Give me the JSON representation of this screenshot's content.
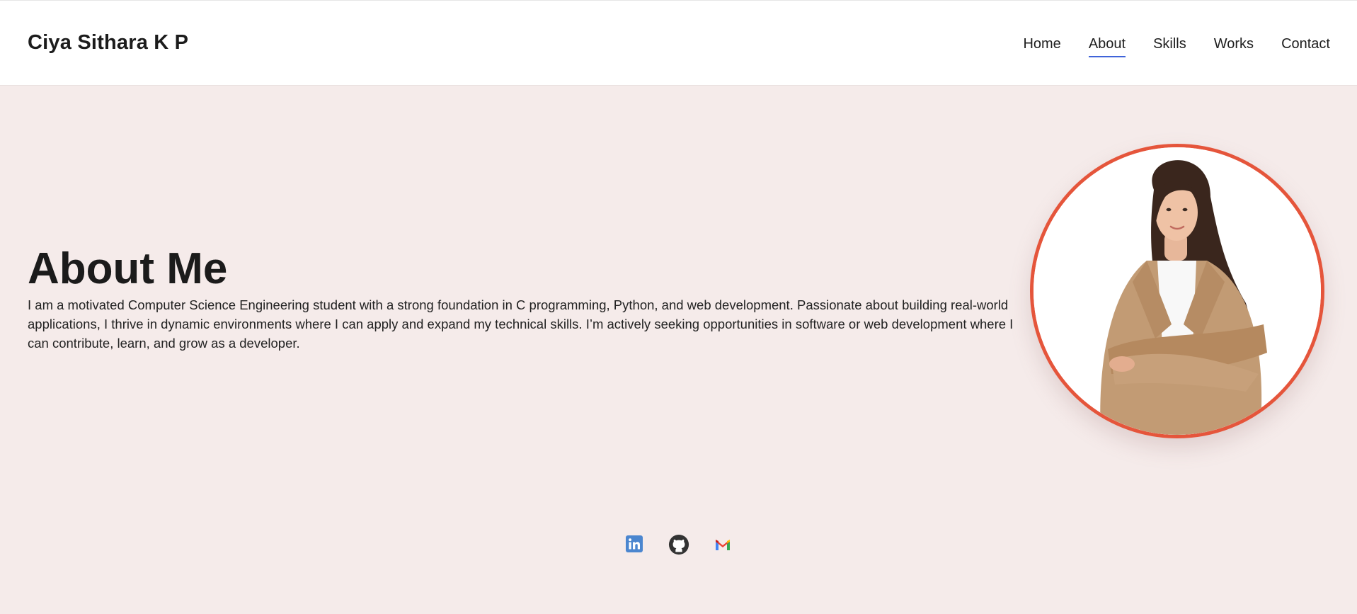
{
  "header": {
    "brand": "Ciya Sithara K P",
    "nav": [
      {
        "label": "Home"
      },
      {
        "label": "About",
        "active": true
      },
      {
        "label": "Skills"
      },
      {
        "label": "Works"
      },
      {
        "label": "Contact"
      }
    ],
    "active_underline_color": "#3f63d9"
  },
  "about": {
    "title": "About Me",
    "text": "I am a motivated Computer Science Engineering student with a strong foundation in C programming, Python, and web development. Passionate about building real-world applications, I thrive in dynamic environments where I can apply and expand my technical skills. I’m actively seeking opportunities in software or web development where I can contribute, learn, and grow as a developer."
  },
  "portrait": {
    "icon": "profile-photo",
    "border_color": "#e5553b"
  },
  "socials": [
    {
      "icon": "linkedin-icon",
      "color": "#0a66c2"
    },
    {
      "icon": "github-icon",
      "color": "#24292f"
    },
    {
      "icon": "gmail-icon",
      "color": "#ea4335"
    }
  ],
  "colors": {
    "background": "#f5ebea",
    "header_background": "#ffffff"
  }
}
